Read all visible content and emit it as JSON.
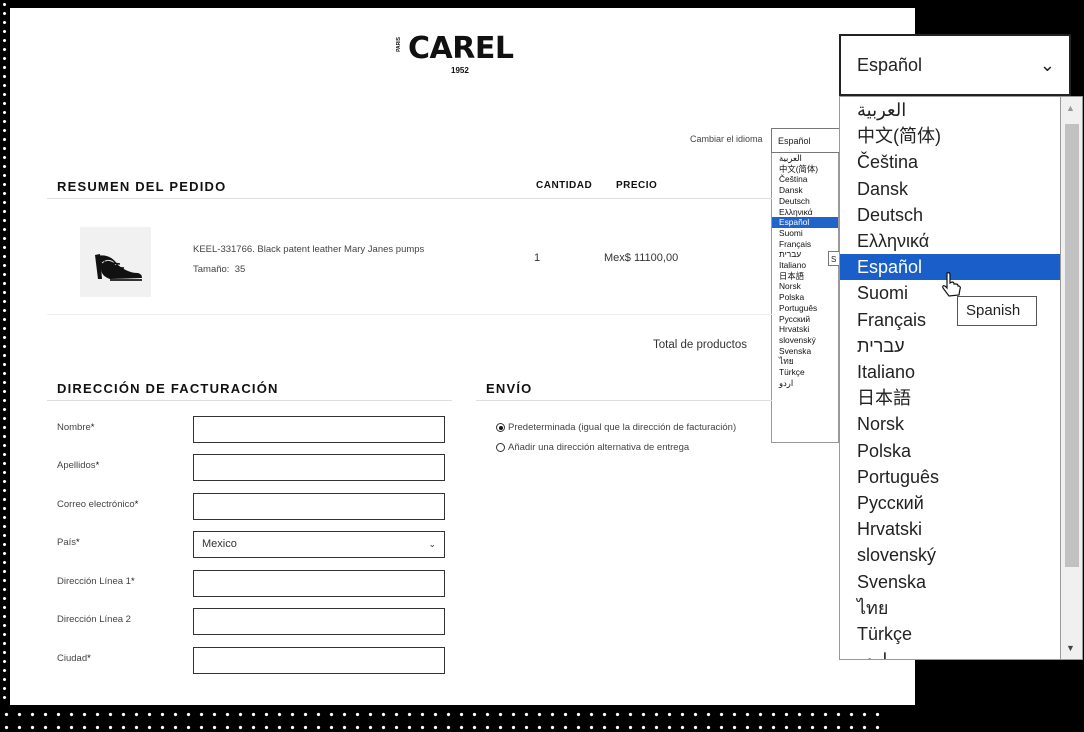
{
  "brand": {
    "name": "CAREL",
    "side_text": "PARIS",
    "year": "1952"
  },
  "language": {
    "label": "Cambiar el idioma",
    "selected": "Español",
    "options": [
      "العربية",
      "中文(简体)",
      "Čeština",
      "Dansk",
      "Deutsch",
      "Ελληνικά",
      "Español",
      "Suomi",
      "Français",
      "עברית",
      "Italiano",
      "日本語",
      "Norsk",
      "Polska",
      "Português",
      "Русский",
      "Hrvatski",
      "slovenský",
      "Svenska",
      "ไทย",
      "Türkçe",
      "اردو"
    ],
    "tooltip": "Spanish",
    "tooltip_small": "S"
  },
  "order": {
    "heading": "RESUMEN DEL PEDIDO",
    "col_quantity": "CANTIDAD",
    "col_price": "PRECIO",
    "item": {
      "name": "KEEL-331766. Black patent leather Mary Janes pumps",
      "size_label": "Tamaño:",
      "size_value": "35",
      "quantity": "1",
      "price": "Mex$ 11100,00"
    },
    "total_label": "Total de productos"
  },
  "billing": {
    "heading": "DIRECCIÓN DE FACTURACIÓN",
    "fields": [
      {
        "label": "Nombre",
        "required": "*"
      },
      {
        "label": "Apellidos",
        "required": "*"
      },
      {
        "label": "Correo electrónico",
        "required": "*"
      },
      {
        "label": "País",
        "required": "*",
        "value": "Mexico"
      },
      {
        "label": "Dirección Línea 1",
        "required": "*"
      },
      {
        "label": "Dirección Línea 2",
        "required": ""
      },
      {
        "label": "Ciudad",
        "required": "*"
      }
    ]
  },
  "shipping": {
    "heading": "ENVÍO",
    "options": [
      {
        "label": "Predeterminada (igual que la dirección de facturación)",
        "checked": true
      },
      {
        "label": "Añadir una dirección alternativa de entrega",
        "checked": false
      }
    ]
  },
  "icons": {
    "chevron": "chevron-down-icon",
    "cursor": "pointer-cursor-icon"
  }
}
